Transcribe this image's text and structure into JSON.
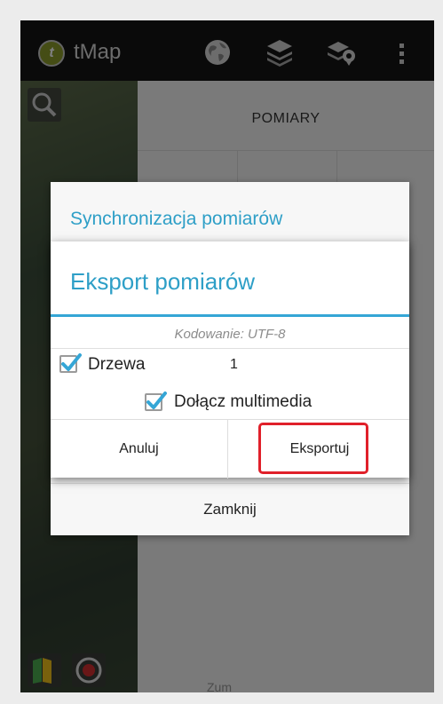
{
  "app": {
    "title": "tMap",
    "logo_letter": "t"
  },
  "actionbar": {
    "icons": [
      "globe-icon",
      "layers-icon",
      "layers-pin-icon",
      "overflow-icon"
    ]
  },
  "panel": {
    "title": "POMIARY",
    "zoom_text": "Zum"
  },
  "sync_dialog": {
    "title": "Synchronizacja pomiarów",
    "close_label": "Zamknij"
  },
  "export_dialog": {
    "title": "Eksport pomiarów",
    "encoding": "Kodowanie: UTF-8",
    "items": [
      {
        "label": "Drzewa",
        "count": "1",
        "checked": true
      }
    ],
    "include_media": {
      "label": "Dołącz multimedia",
      "checked": true
    },
    "cancel_label": "Anuluj",
    "export_label": "Eksportuj"
  },
  "colors": {
    "accent": "#2e9fc7",
    "highlight": "#e0202a",
    "actionbar": "#141414"
  }
}
